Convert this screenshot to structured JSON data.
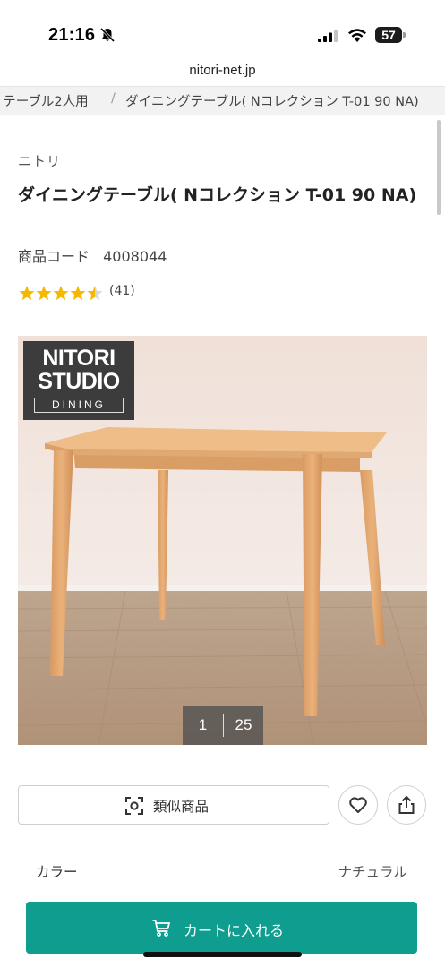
{
  "status_bar": {
    "time": "21:16",
    "battery": "57"
  },
  "browser": {
    "url": "nitori-net.jp"
  },
  "breadcrumb": {
    "items": [
      "ﾞテーブル2人用",
      "ダイニングテーブル( Nコレクション T-01 90 NA)"
    ],
    "separator": "/"
  },
  "product": {
    "brand": "ニトリ",
    "title": "ダイニングテーブル( Nコレクション T-01 90 NA)",
    "code_label": "商品コード",
    "code_value": "4008044",
    "rating": {
      "stars": 4.5,
      "count": "(41)",
      "star_color": "#f5b800"
    }
  },
  "gallery": {
    "logo": {
      "line1": "NITORI",
      "line2": "STUDIO",
      "line3": "DINING"
    },
    "current": "1",
    "total": "25"
  },
  "actions": {
    "similar_label": "類似商品",
    "similar_icon": "scan-icon",
    "favorite_icon": "heart-icon",
    "share_icon": "share-icon"
  },
  "options": {
    "color_label": "カラー",
    "color_value": "ナチュラル"
  },
  "cart": {
    "label": "カートに入れる",
    "icon": "cart-icon",
    "color": "#0f9d8f"
  }
}
